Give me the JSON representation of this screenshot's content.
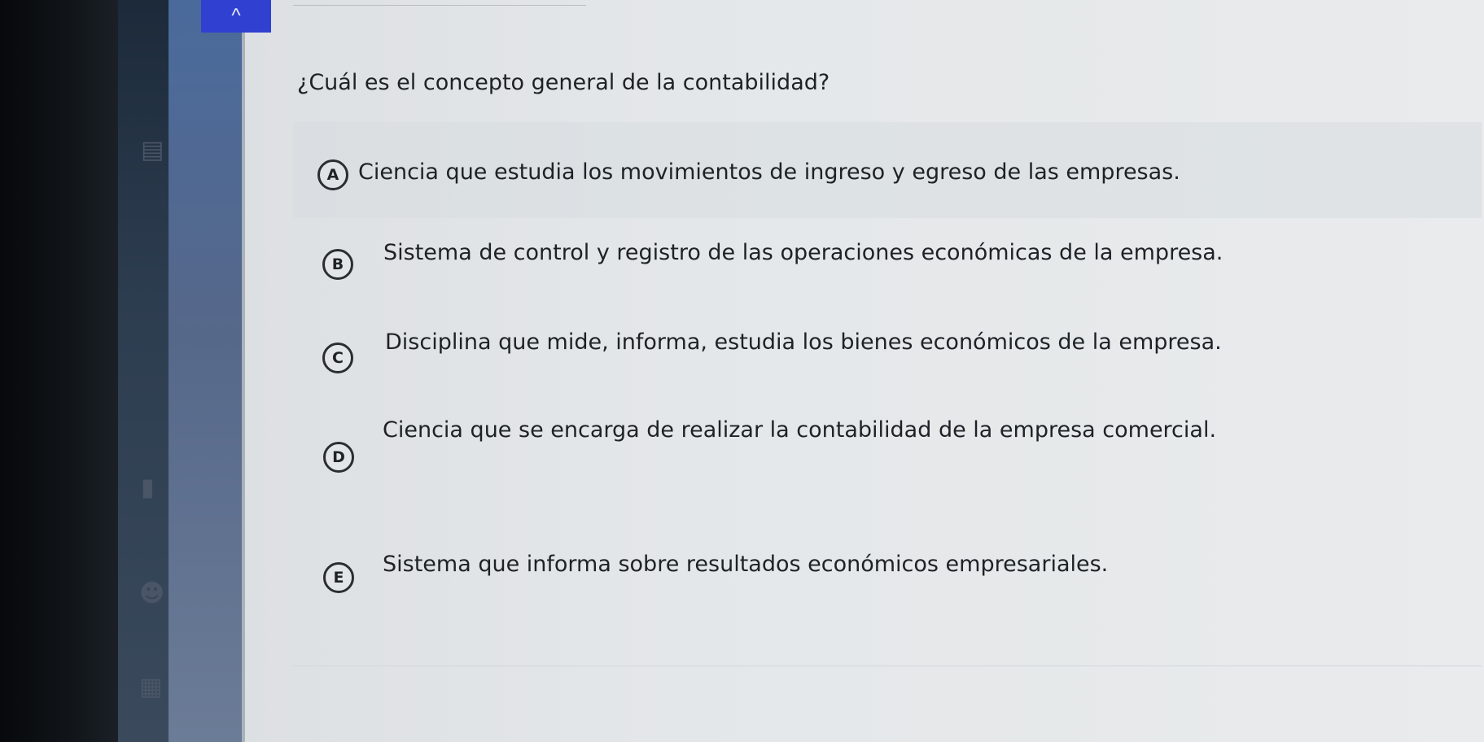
{
  "window": {
    "collapse_glyph": "^"
  },
  "question": {
    "text": "¿Cuál es el concepto general de la contabilidad?"
  },
  "options": [
    {
      "letter": "A",
      "text": "Ciencia que estudia los movimientos de ingreso y egreso de las empresas."
    },
    {
      "letter": "B",
      "text": "Sistema de control y registro de las operaciones económicas de la empresa."
    },
    {
      "letter": "C",
      "text": "Disciplina que mide, informa, estudia los bienes económicos de la empresa."
    },
    {
      "letter": "D",
      "text": "Ciencia que se encarga de realizar la contabilidad de la empresa comercial."
    },
    {
      "letter": "E",
      "text": "Sistema que informa sobre resultados económicos empresariales."
    }
  ],
  "icons": {
    "rail_icon_1": "book-icon",
    "rail_icon_2": "folder-icon",
    "rail_icon_3": "people-icon",
    "rail_icon_4": "calendar-icon"
  },
  "colors": {
    "accent": "#3040d0",
    "text": "#1e2226",
    "rail": "#56688a"
  }
}
